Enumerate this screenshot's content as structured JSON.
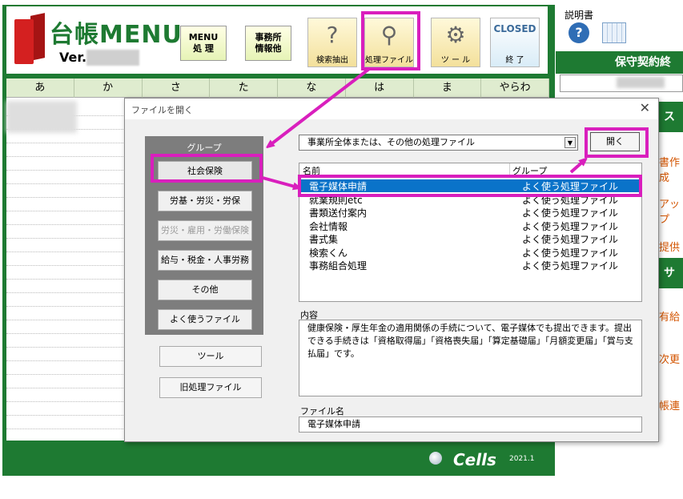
{
  "app": {
    "title": "台帳MENU",
    "version_prefix": "Ver.",
    "toolbar": {
      "menu_label": "MENU\n処 理",
      "office_label": "事務所\n情報他",
      "search_label": "検索抽出",
      "files_label": "処理ファイル",
      "tools_label": "ツ ー ル",
      "closed_label": "CLOSED",
      "exit_label": "終 了"
    },
    "kana_tabs": [
      "あ",
      "か",
      "さ",
      "た",
      "な",
      "は",
      "ま",
      "やらわ"
    ],
    "footer": {
      "brand": "Cells",
      "year": "2021.1"
    },
    "right_panel": {
      "manual_label": "説明書",
      "contract_header": "保守契約終",
      "links": [
        "書作成",
        "アップ",
        "提供",
        "有給",
        "次更",
        "帳連"
      ],
      "strips": [
        "ス",
        "サオ"
      ]
    }
  },
  "dialog": {
    "title": "ファイルを開く",
    "close_glyph": "✕",
    "group": {
      "title": "グループ",
      "buttons": [
        {
          "label": "社会保険",
          "state": "selected"
        },
        {
          "label": "労基・労災・労保",
          "state": "normal"
        },
        {
          "label": "労災・雇用・労働保険",
          "state": "disabled"
        },
        {
          "label": "給与・税金・人事労務",
          "state": "normal"
        },
        {
          "label": "その他",
          "state": "normal"
        },
        {
          "label": "よく使うファイル",
          "state": "normal"
        }
      ]
    },
    "side_buttons": [
      {
        "label": "ツール"
      },
      {
        "label": "旧処理ファイル"
      }
    ],
    "combo": {
      "value": "事業所全体または、その他の処理ファイル",
      "arrow_glyph": "▼"
    },
    "open_button": "開く",
    "file_list": {
      "col_name": "名前",
      "col_group": "グループ",
      "rows": [
        {
          "name": "電子媒体申請",
          "group": "よく使う処理ファイル",
          "selected": true
        },
        {
          "name": "就業規則etc",
          "group": "よく使う処理ファイル",
          "selected": false
        },
        {
          "name": "書類送付案内",
          "group": "よく使う処理ファイル",
          "selected": false
        },
        {
          "name": "会社情報",
          "group": "よく使う処理ファイル",
          "selected": false
        },
        {
          "name": "書式集",
          "group": "よく使う処理ファイル",
          "selected": false
        },
        {
          "name": "検索くん",
          "group": "よく使う処理ファイル",
          "selected": false
        },
        {
          "name": "事務組合処理",
          "group": "よく使う処理ファイル",
          "selected": false
        }
      ]
    },
    "content": {
      "label": "内容",
      "text": "健康保険・厚生年金の適用関係の手続について、電子媒体でも提出できます。提出できる手続きは「資格取得届」「資格喪失届」「算定基礎届」「月額変更届」「賞与支払届」です。"
    },
    "filename": {
      "label": "ファイル名",
      "value": "電子媒体申請"
    }
  },
  "colors": {
    "app_green": "#1e7a32",
    "highlight_magenta": "#d91fbd",
    "selection_blue": "#0a73c9"
  }
}
